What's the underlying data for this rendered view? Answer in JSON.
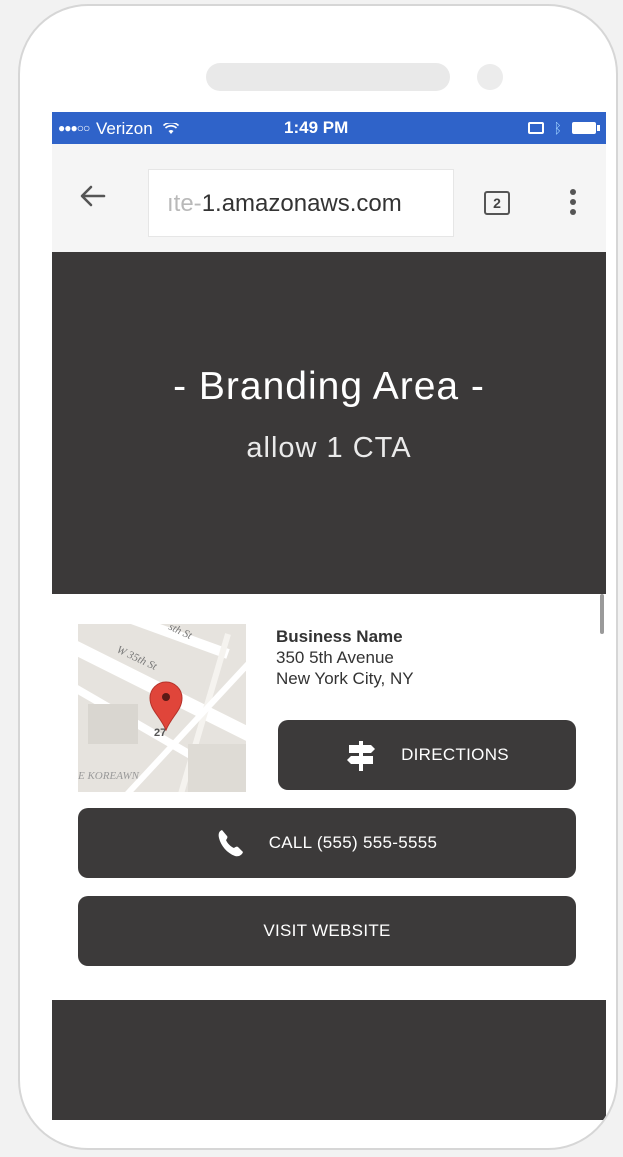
{
  "status_bar": {
    "carrier": "Verizon",
    "time": "1:49 PM"
  },
  "browser": {
    "url_faded": "ıte-",
    "url_main": "1.amazonaws.com",
    "tab_count": "2"
  },
  "branding": {
    "title": "- Branding Area -",
    "subtitle": "allow 1 CTA"
  },
  "business": {
    "name": "Business Name",
    "address_line1": "350 5th Avenue",
    "address_line2": "New York City, NY",
    "map_labels": [
      "W 35th St",
      "sth St",
      "E KOREAWN"
    ]
  },
  "buttons": {
    "directions": "DIRECTIONS",
    "call": "CALL (555) 555-5555",
    "website": "VISIT WEBSITE"
  },
  "colors": {
    "status_bar": "#2f63c9",
    "dark": "#3b3939",
    "button": "#3c3a3a",
    "pin": "#e0453a"
  },
  "icons": [
    "back-arrow-icon",
    "tabs-icon",
    "overflow-menu-icon",
    "wifi-icon",
    "airplay-icon",
    "bluetooth-icon",
    "battery-icon",
    "signpost-icon",
    "phone-icon",
    "map-pin-icon"
  ]
}
